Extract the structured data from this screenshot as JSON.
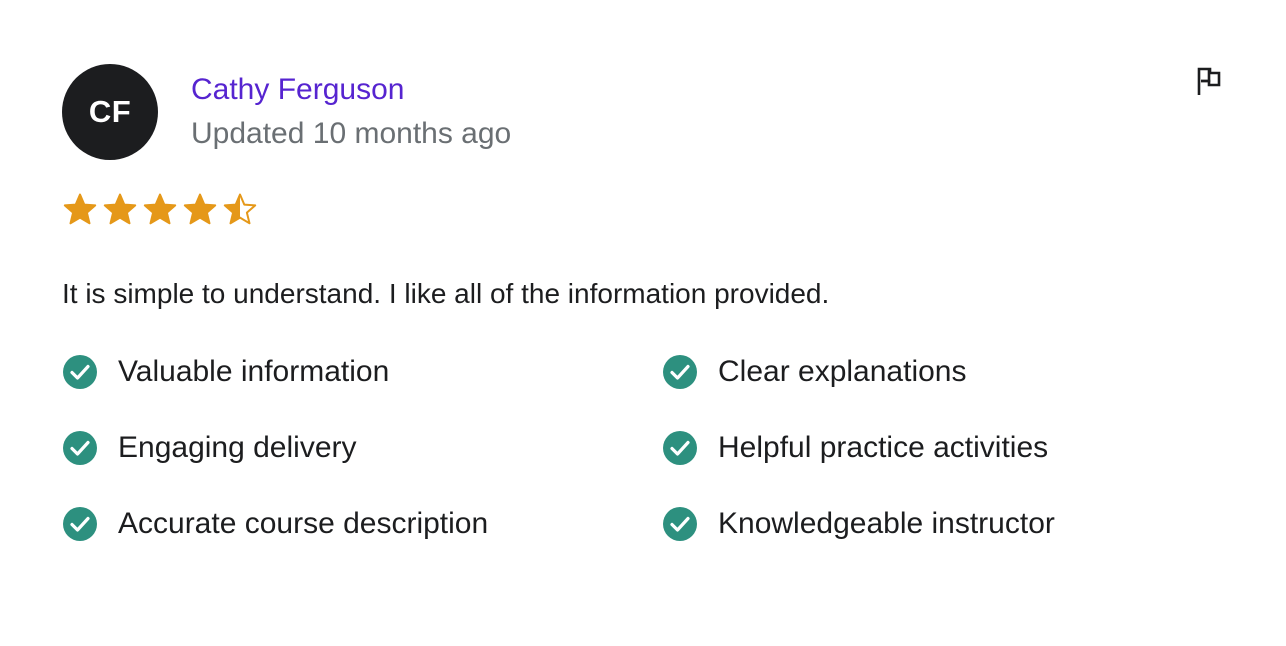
{
  "review": {
    "avatar_initials": "CF",
    "reviewer_name": "Cathy Ferguson",
    "updated_text": "Updated 10 months ago",
    "rating": 4.5,
    "rating_max": 5,
    "text": "It is simple to understand. I like all of the information provided.",
    "aspects": [
      {
        "label": "Valuable information",
        "checked": true
      },
      {
        "label": "Clear explanations",
        "checked": true
      },
      {
        "label": "Engaging delivery",
        "checked": true
      },
      {
        "label": "Helpful practice activities",
        "checked": true
      },
      {
        "label": "Accurate course description",
        "checked": true
      },
      {
        "label": "Knowledgeable instructor",
        "checked": true
      }
    ]
  },
  "icons": {
    "flag": "flag-icon",
    "star": "star-icon",
    "check": "check-circle-icon"
  },
  "colors": {
    "name_link": "#5624d0",
    "star": "#e59819",
    "check": "#2d907f",
    "avatar_bg": "#1c1d1f",
    "muted_text": "#6a6f73",
    "text": "#1c1d1f"
  }
}
